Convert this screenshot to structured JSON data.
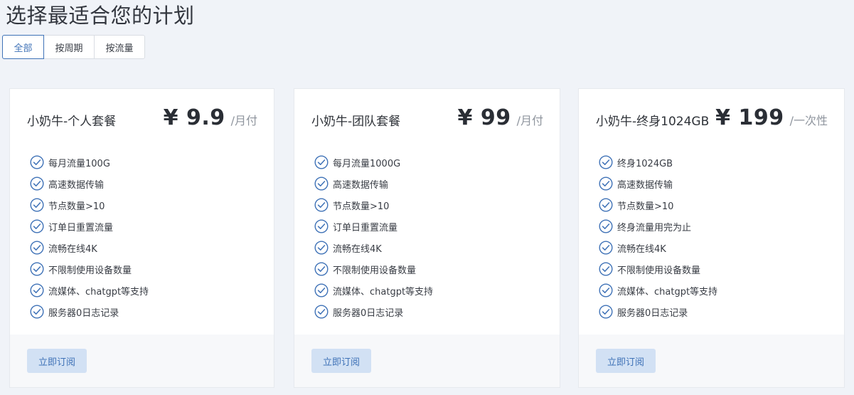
{
  "page_title": "选择最适合您的计划",
  "filters": [
    {
      "label": "全部",
      "active": true
    },
    {
      "label": "按周期",
      "active": false
    },
    {
      "label": "按流量",
      "active": false
    }
  ],
  "plans": [
    {
      "name": "小奶牛-个人套餐",
      "price": "¥ 9.9",
      "period": "/月付",
      "features": [
        "每月流量100G",
        "高速数据传输",
        "节点数量>10",
        "订单日重置流量",
        "流畅在线4K",
        "不限制使用设备数量",
        "流媒体、chatgpt等支持",
        "服务器0日志记录"
      ],
      "button_label": "立即订阅"
    },
    {
      "name": "小奶牛-团队套餐",
      "price": "¥ 99",
      "period": "/月付",
      "features": [
        "每月流量1000G",
        "高速数据传输",
        "节点数量>10",
        "订单日重置流量",
        "流畅在线4K",
        "不限制使用设备数量",
        "流媒体、chatgpt等支持",
        "服务器0日志记录"
      ],
      "button_label": "立即订阅"
    },
    {
      "name": "小奶牛-终身1024GB",
      "price": "¥ 199",
      "period": "/一次性",
      "features": [
        "终身1024GB",
        "高速数据传输",
        "节点数量>10",
        "终身流量用完为止",
        "流畅在线4K",
        "不限制使用设备数量",
        "流媒体、chatgpt等支持",
        "服务器0日志记录"
      ],
      "button_label": "立即订阅"
    }
  ],
  "colors": {
    "accent": "#3f72b7",
    "check": "#3f72b7",
    "button_bg": "#d2e1f4"
  },
  "icons": {
    "feature": "check-circle-icon"
  }
}
